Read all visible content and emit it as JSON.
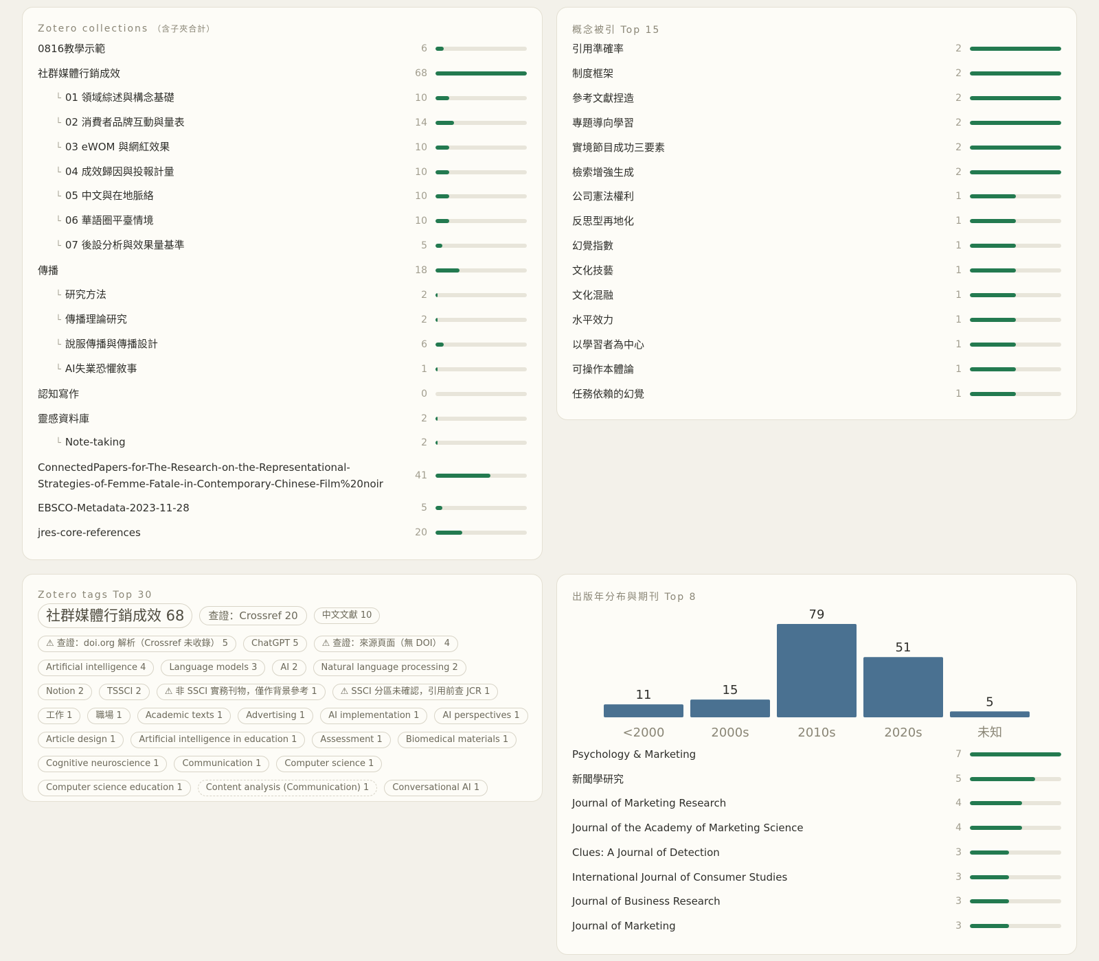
{
  "collections": {
    "title": "Zotero collections",
    "title_suffix": "（含子夾合計）",
    "max": 68,
    "items": [
      {
        "label": "0816教學示範",
        "count": 6,
        "depth": 0
      },
      {
        "label": "社群媒體行銷成效",
        "count": 68,
        "depth": 0
      },
      {
        "label": "01 領域綜述與構念基礎",
        "count": 10,
        "depth": 1
      },
      {
        "label": "02 消費者品牌互動與量表",
        "count": 14,
        "depth": 1
      },
      {
        "label": "03 eWOM 與網紅效果",
        "count": 10,
        "depth": 1
      },
      {
        "label": "04 成效歸因與投報計量",
        "count": 10,
        "depth": 1
      },
      {
        "label": "05 中文與在地脈絡",
        "count": 10,
        "depth": 1
      },
      {
        "label": "06 華語圈平臺情境",
        "count": 10,
        "depth": 1
      },
      {
        "label": "07 後設分析與效果量基準",
        "count": 5,
        "depth": 1
      },
      {
        "label": "傳播",
        "count": 18,
        "depth": 0
      },
      {
        "label": "研究方法",
        "count": 2,
        "depth": 1
      },
      {
        "label": "傳播理論研究",
        "count": 2,
        "depth": 1
      },
      {
        "label": "說服傳播與傳播設計",
        "count": 6,
        "depth": 1
      },
      {
        "label": "AI失業恐懼敘事",
        "count": 1,
        "depth": 1
      },
      {
        "label": "認知寫作",
        "count": 0,
        "depth": 0
      },
      {
        "label": "靈感資料庫",
        "count": 2,
        "depth": 0
      },
      {
        "label": "Note-taking",
        "count": 2,
        "depth": 1
      },
      {
        "label": "ConnectedPapers-for-The-Research-on-the-Representational-Strategies-of-Femme-Fatale-in-Contemporary-Chinese-Film%20noir",
        "count": 41,
        "depth": 0
      },
      {
        "label": "EBSCO-Metadata-2023-11-28",
        "count": 5,
        "depth": 0
      },
      {
        "label": "jres-core-references",
        "count": 20,
        "depth": 0
      }
    ]
  },
  "concepts": {
    "title": "概念被引 Top 15",
    "max": 2,
    "items": [
      {
        "label": "引用準確率",
        "count": 2
      },
      {
        "label": "制度框架",
        "count": 2
      },
      {
        "label": "參考文獻捏造",
        "count": 2
      },
      {
        "label": "專題導向學習",
        "count": 2
      },
      {
        "label": "實境節目成功三要素",
        "count": 2
      },
      {
        "label": "檢索增強生成",
        "count": 2
      },
      {
        "label": "公司憲法權利",
        "count": 1
      },
      {
        "label": "反思型再地化",
        "count": 1
      },
      {
        "label": "幻覺指數",
        "count": 1
      },
      {
        "label": "文化技藝",
        "count": 1
      },
      {
        "label": "文化混融",
        "count": 1
      },
      {
        "label": "水平效力",
        "count": 1
      },
      {
        "label": "以學習者為中心",
        "count": 1
      },
      {
        "label": "可操作本體論",
        "count": 1
      },
      {
        "label": "任務依賴的幻覺",
        "count": 1
      }
    ]
  },
  "tags": {
    "title": "Zotero tags Top 30",
    "lines": [
      [
        {
          "text": "社群媒體行銷成效 68",
          "size": "xl"
        },
        {
          "text": "查證：Crossref 20",
          "size": "lg"
        },
        {
          "text": "中文文獻 10",
          "size": "md"
        }
      ],
      [
        {
          "text": "⚠ 查證：doi.org 解析（Crossref 未收錄） 5",
          "size": "sm"
        },
        {
          "text": "ChatGPT 5",
          "size": "md"
        },
        {
          "text": "⚠ 查證：來源頁面（無 DOI） 4",
          "size": "sm"
        }
      ],
      [
        {
          "text": "Artificial intelligence 4",
          "size": "sm"
        },
        {
          "text": "Language models 3",
          "size": "sm"
        },
        {
          "text": "AI 2",
          "size": "sm"
        },
        {
          "text": "Natural language processing 2",
          "size": "sm"
        }
      ],
      [
        {
          "text": "Notion 2",
          "size": "sm"
        },
        {
          "text": "TSSCI 2",
          "size": "sm"
        },
        {
          "text": "⚠ 非 SSCI 實務刊物，僅作背景參考 1",
          "size": "sm"
        },
        {
          "text": "⚠ SSCI 分區未確認，引用前查 JCR 1",
          "size": "sm"
        }
      ],
      [
        {
          "text": "工作 1",
          "size": "sm"
        },
        {
          "text": "職場 1",
          "size": "sm"
        },
        {
          "text": "Academic texts 1",
          "size": "sm"
        },
        {
          "text": "Advertising 1",
          "size": "sm"
        },
        {
          "text": "AI implementation 1",
          "size": "sm"
        },
        {
          "text": "AI perspectives 1",
          "size": "sm"
        }
      ],
      [
        {
          "text": "Article design 1",
          "size": "sm"
        },
        {
          "text": "Artificial intelligence in education 1",
          "size": "sm"
        },
        {
          "text": "Assessment 1",
          "size": "sm"
        },
        {
          "text": "Biomedical materials 1",
          "size": "sm"
        }
      ],
      [
        {
          "text": "Cognitive neuroscience 1",
          "size": "sm"
        },
        {
          "text": "Communication 1",
          "size": "sm"
        },
        {
          "text": "Computer science 1",
          "size": "sm"
        }
      ],
      [
        {
          "text": "Computer science education 1",
          "size": "sm"
        },
        {
          "text": "Content analysis (Communication) 1",
          "size": "sm",
          "dashed": true
        },
        {
          "text": "Conversational AI 1",
          "size": "sm"
        }
      ]
    ]
  },
  "years": {
    "title": "出版年分布與期刊 Top 8",
    "chart_data": {
      "type": "bar",
      "categories": [
        "<2000",
        "2000s",
        "2010s",
        "2020s",
        "未知"
      ],
      "values": [
        11,
        15,
        79,
        51,
        5
      ],
      "ylim": [
        0,
        79
      ]
    },
    "bar_color": "#4a7191",
    "journals_max": 7,
    "journals": [
      {
        "label": "Psychology & Marketing",
        "count": 7
      },
      {
        "label": "新聞學研究",
        "count": 5
      },
      {
        "label": "Journal of Marketing Research",
        "count": 4
      },
      {
        "label": "Journal of the Academy of Marketing Science",
        "count": 4
      },
      {
        "label": "Clues: A Journal of Detection",
        "count": 3
      },
      {
        "label": "International Journal of Consumer Studies",
        "count": 3
      },
      {
        "label": "Journal of Business Research",
        "count": 3
      },
      {
        "label": "Journal of Marketing",
        "count": 3
      }
    ]
  },
  "colors": {
    "accent": "#237a50",
    "track": "#e8e5da"
  }
}
